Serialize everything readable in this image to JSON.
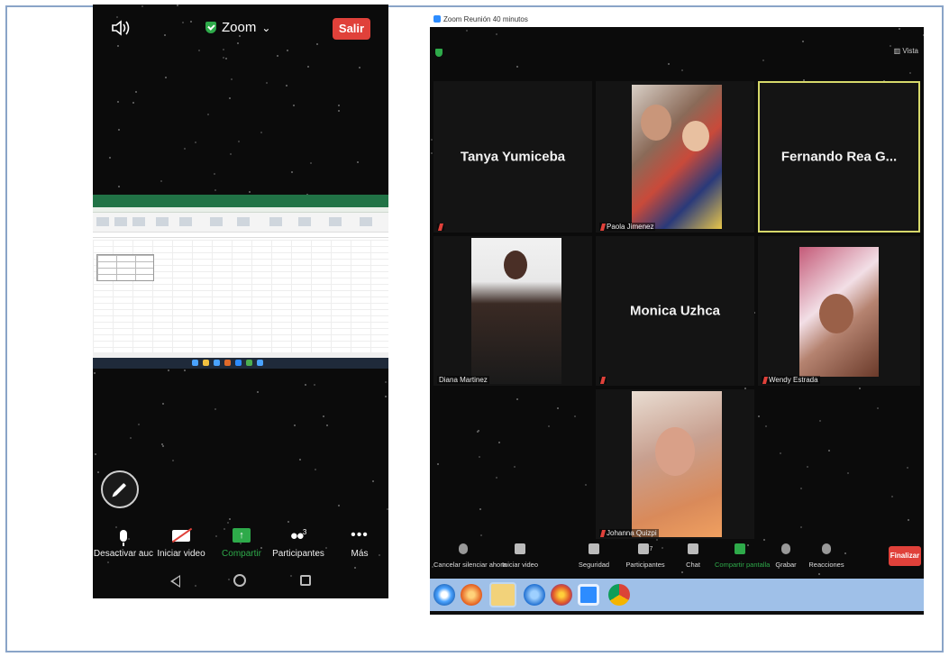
{
  "phone": {
    "title": "Zoom",
    "title_caret": "⌄",
    "exit_label": "Salir",
    "toolbar": [
      {
        "id": "mute",
        "label": "Desactivar auc"
      },
      {
        "id": "video",
        "label": "Iniciar video"
      },
      {
        "id": "share",
        "label": "Compartir"
      },
      {
        "id": "participants",
        "label": "Participantes",
        "count": "3"
      },
      {
        "id": "more",
        "label": "Más"
      }
    ]
  },
  "desktop": {
    "window_title": "Zoom Reunión 40 minutos",
    "view_label": "Vista",
    "participants": [
      {
        "name": "Tanya Yumiceba",
        "video": false
      },
      {
        "name": "Paola Jimenez",
        "video": true
      },
      {
        "name": "Fernando Rea G...",
        "video": false,
        "active_speaker": true
      },
      {
        "name": "Diana Martinez",
        "video": true
      },
      {
        "name": "Monica Uzhca",
        "video": false
      },
      {
        "name": "Wendy Estrada",
        "video": true
      },
      {
        "name": "Johanna Quizpi",
        "video": true
      }
    ],
    "toolbar": [
      {
        "id": "unmute",
        "label": "Cancelar silenciar ahora"
      },
      {
        "id": "start-video",
        "label": "Iniciar video"
      },
      {
        "id": "security",
        "label": "Seguridad"
      },
      {
        "id": "participants",
        "label": "Participantes",
        "count": "7"
      },
      {
        "id": "chat",
        "label": "Chat"
      },
      {
        "id": "share",
        "label": "Compartir pantalla"
      },
      {
        "id": "record",
        "label": "Grabar"
      },
      {
        "id": "reactions",
        "label": "Reacciones"
      }
    ],
    "end_label": "Finalizar",
    "taskbar_icons": [
      "windows-start-icon",
      "media-player-icon",
      "file-explorer-icon",
      "internet-explorer-icon",
      "firefox-icon",
      "zoom-icon",
      "chrome-icon"
    ],
    "colors": {
      "share_green": "#2eaa4a",
      "end_red": "#e0413a",
      "speaker_border": "#d6d86a",
      "taskbar": "#9fc0e8"
    }
  }
}
